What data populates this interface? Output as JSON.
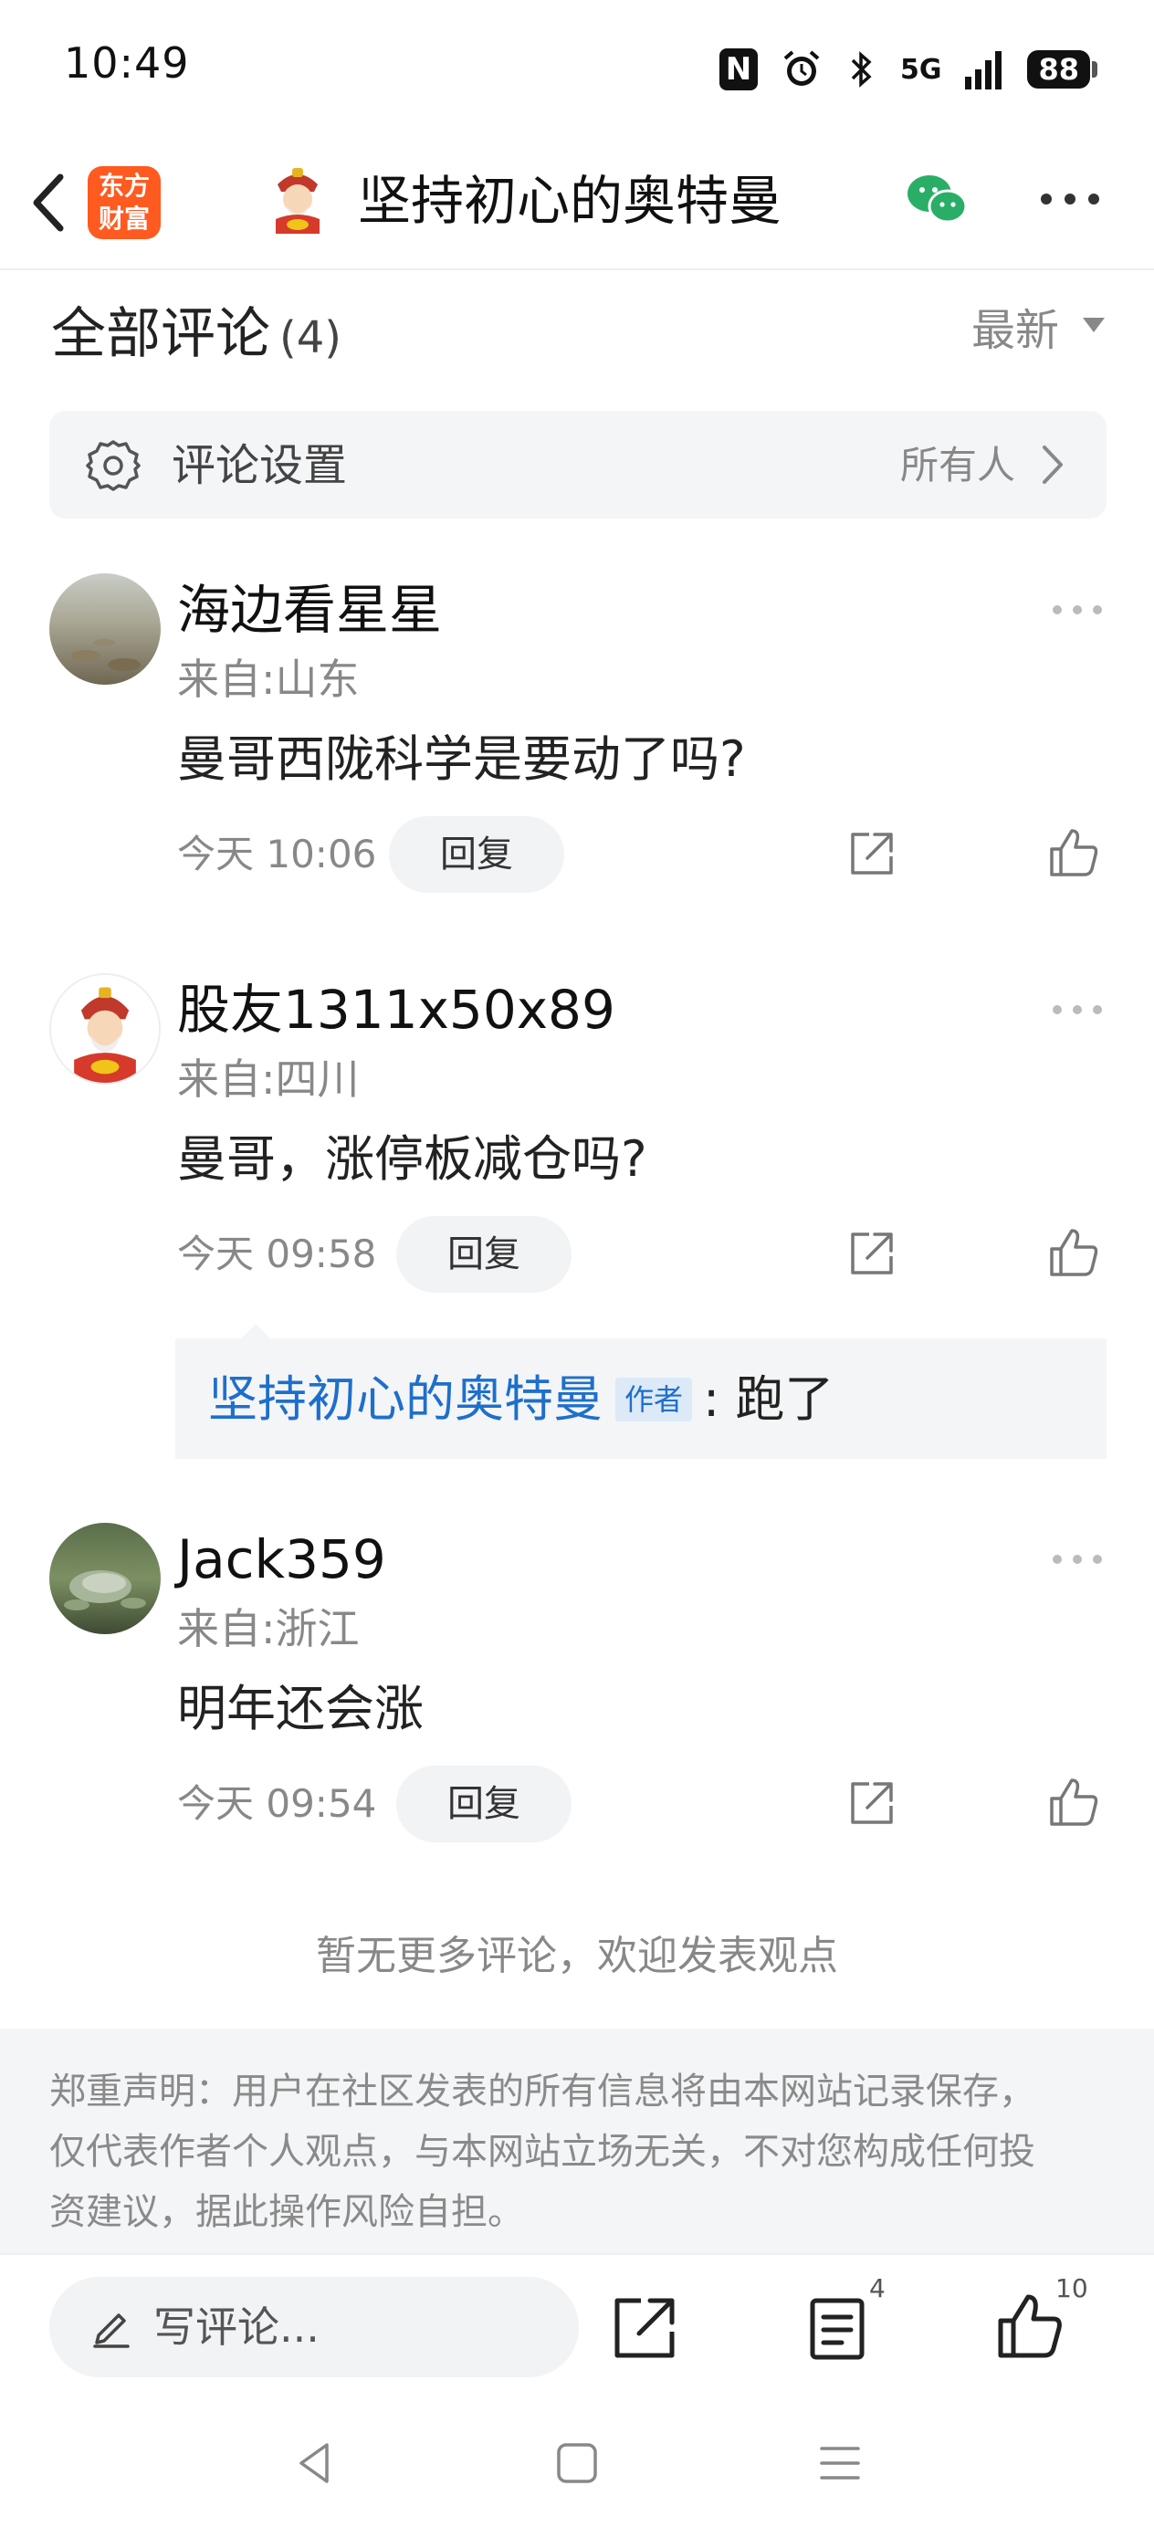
{
  "status_bar": {
    "time": "10:49",
    "nfc": "N",
    "signal": "5G",
    "battery": "88"
  },
  "header": {
    "logo_line1": "东方",
    "logo_line2": "财富",
    "title": "坚持初心的奥特曼",
    "icons": [
      "back-icon",
      "wechat-icon",
      "more-icon"
    ]
  },
  "comments_section": {
    "title": "全部评论",
    "count": "(4)",
    "sort_label": "最新"
  },
  "settings": {
    "label": "评论设置",
    "value": "所有人"
  },
  "comments": [
    {
      "name": "海边看星星",
      "location": "来自:山东",
      "text": "曼哥西陇科学是要动了吗?",
      "time": "今天 10:06",
      "reply_label": "回复"
    },
    {
      "name": "股友1311x50x89",
      "location": "来自:四川",
      "text": "曼哥，涨停板减仓吗?",
      "time": "今天 09:58",
      "reply_label": "回复",
      "reply": {
        "author": "坚持初心的奥特曼",
        "badge": "作者",
        "text": ": 跑了"
      }
    },
    {
      "name": "Jack359",
      "location": "来自:浙江",
      "text": "明年还会涨",
      "time": "今天 09:54",
      "reply_label": "回复"
    }
  ],
  "no_more_text": "暂无更多评论，欢迎发表观点",
  "disclaimer": {
    "line1": "郑重声明：用户在社区发表的所有信息将由本网站记录保存，",
    "line2": "仅代表作者个人观点，与本网站立场无关，不对您构成任何投",
    "line3": "资建议，据此操作风险自担。"
  },
  "bottom_bar": {
    "write_placeholder": "写评论...",
    "comment_count": "4",
    "like_count": "10"
  },
  "colors": {
    "accent_blue": "#1e6fcc",
    "brand_orange": "#ff5a1f",
    "wechat_green": "#2aae67"
  }
}
